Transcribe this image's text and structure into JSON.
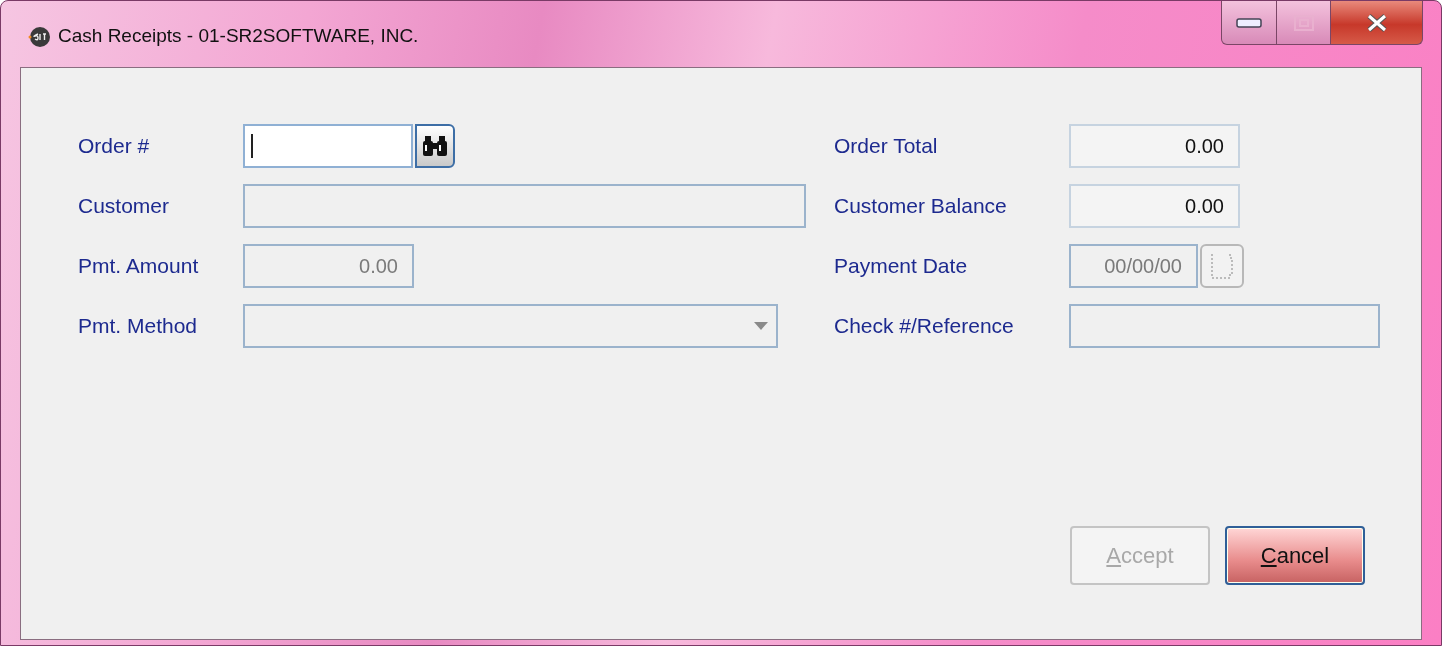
{
  "window": {
    "title": "Cash Receipts  -  01-SR2SOFTWARE, INC."
  },
  "left_fields": [
    {
      "label": "Order #",
      "kind": "lookup",
      "focused": true,
      "disabled": false
    },
    {
      "label": "Customer",
      "kind": "text",
      "disabled": true
    },
    {
      "label": "Pmt. Amount",
      "kind": "number",
      "value": "0.00",
      "disabled": true
    },
    {
      "label": "Pmt. Method",
      "kind": "dropdown",
      "disabled": true
    }
  ],
  "right_fields": [
    {
      "label": "Order Total",
      "kind": "number",
      "value": "0.00",
      "disabled": false
    },
    {
      "label": "Customer Balance",
      "kind": "number",
      "value": "0.00",
      "disabled": false
    },
    {
      "label": "Payment Date",
      "kind": "date",
      "value": "00/00/00",
      "disabled": true
    },
    {
      "label": "Check #/Reference",
      "kind": "text",
      "disabled": true
    }
  ],
  "buttons": [
    {
      "label": "Accept",
      "mnemonic": true,
      "disabled": true,
      "default": false
    },
    {
      "label": "Cancel",
      "mnemonic": true,
      "disabled": false,
      "default": true
    }
  ]
}
